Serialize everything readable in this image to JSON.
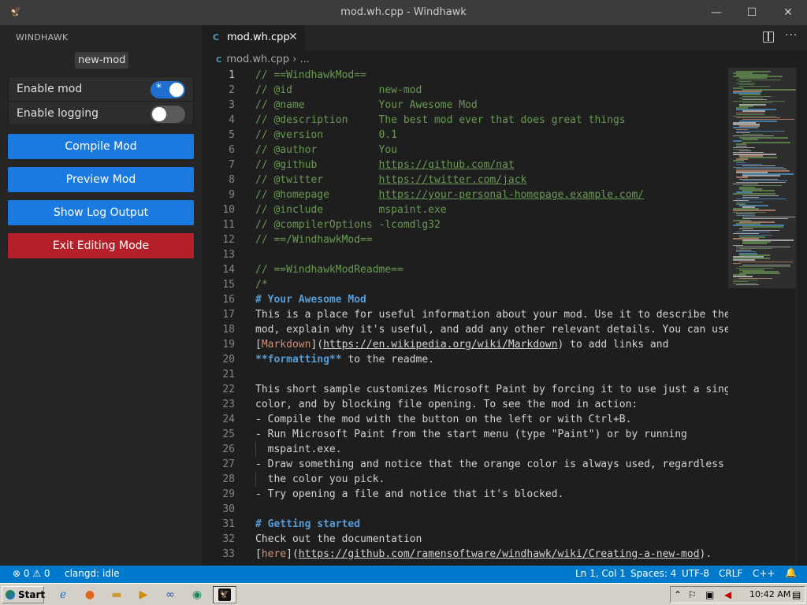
{
  "window": {
    "title": "mod.wh.cpp - Windhawk",
    "minimize": "—",
    "maximize": "☐",
    "close": "✕"
  },
  "sidebar": {
    "heading": "WINDHAWK",
    "mod_name": "new-mod",
    "toggles": [
      {
        "label": "Enable mod",
        "state": "on"
      },
      {
        "label": "Enable logging",
        "state": "off"
      }
    ],
    "buttons": {
      "compile": "Compile Mod",
      "preview": "Preview Mod",
      "log": "Show Log Output",
      "exit": "Exit Editing Mode"
    },
    "colors": {
      "primary": "#1a7ae0",
      "danger": "#b3202a"
    }
  },
  "editor": {
    "tab_label": "mod.wh.cpp",
    "tab_icon": "C",
    "breadcrumb_file": "mod.wh.cpp",
    "breadcrumb_rest": "...",
    "lines": [
      {
        "n": "1",
        "parts": [
          [
            "cm",
            "// ==WindhawkMod=="
          ]
        ]
      },
      {
        "n": "2",
        "parts": [
          [
            "cm",
            "// @id              new-mod"
          ]
        ]
      },
      {
        "n": "3",
        "parts": [
          [
            "cm",
            "// @name            Your Awesome Mod"
          ]
        ]
      },
      {
        "n": "4",
        "parts": [
          [
            "cm",
            "// @description     The best mod ever that does great things"
          ]
        ]
      },
      {
        "n": "5",
        "parts": [
          [
            "cm",
            "// @version         0.1"
          ]
        ]
      },
      {
        "n": "6",
        "parts": [
          [
            "cm",
            "// @author          You"
          ]
        ]
      },
      {
        "n": "7",
        "parts": [
          [
            "cm",
            "// @github          "
          ],
          [
            "lnk",
            "https://github.com/nat"
          ]
        ]
      },
      {
        "n": "8",
        "parts": [
          [
            "cm",
            "// @twitter         "
          ],
          [
            "lnk",
            "https://twitter.com/jack"
          ]
        ]
      },
      {
        "n": "9",
        "parts": [
          [
            "cm",
            "// @homepage        "
          ],
          [
            "lnk",
            "https://your-personal-homepage.example.com/"
          ]
        ]
      },
      {
        "n": "10",
        "parts": [
          [
            "cm",
            "// @include         mspaint.exe"
          ]
        ]
      },
      {
        "n": "11",
        "parts": [
          [
            "cm",
            "// @compilerOptions -lcomdlg32"
          ]
        ]
      },
      {
        "n": "12",
        "parts": [
          [
            "cm",
            "// ==/WindhawkMod=="
          ]
        ]
      },
      {
        "n": "13",
        "parts": []
      },
      {
        "n": "14",
        "parts": [
          [
            "cm",
            "// ==WindhawkModReadme=="
          ]
        ]
      },
      {
        "n": "15",
        "parts": [
          [
            "cm",
            "/*"
          ]
        ]
      },
      {
        "n": "16",
        "parts": [
          [
            "hd",
            "# Your Awesome Mod"
          ]
        ]
      },
      {
        "n": "17",
        "parts": [
          [
            "txt",
            "This is a place for useful information about your mod. Use it to describe the"
          ]
        ]
      },
      {
        "n": "18",
        "parts": [
          [
            "txt",
            "mod, explain why it's useful, and add any other relevant details. You can use"
          ]
        ]
      },
      {
        "n": "19",
        "parts": [
          [
            "txt",
            "["
          ],
          [
            "md-lnk",
            "Markdown"
          ],
          [
            "txt",
            "]("
          ],
          [
            "txt-u",
            "https://en.wikipedia.org/wiki/Markdown"
          ],
          [
            "txt",
            ") to add links and"
          ]
        ]
      },
      {
        "n": "20",
        "parts": [
          [
            "hd",
            "**formatting**"
          ],
          [
            "txt",
            " to the readme."
          ]
        ]
      },
      {
        "n": "21",
        "parts": []
      },
      {
        "n": "22",
        "parts": [
          [
            "txt",
            "This short sample customizes Microsoft Paint by forcing it to use just a singl"
          ]
        ]
      },
      {
        "n": "23",
        "parts": [
          [
            "txt",
            "color, and by blocking file opening. To see the mod in action:"
          ]
        ]
      },
      {
        "n": "24",
        "parts": [
          [
            "txt",
            "- Compile the mod with the button on the left or with Ctrl+B."
          ]
        ]
      },
      {
        "n": "25",
        "parts": [
          [
            "txt",
            "- Run Microsoft Paint from the start menu (type \"Paint\") or by running"
          ]
        ]
      },
      {
        "n": "26",
        "parts": [
          [
            "txt",
            "  mspaint.exe."
          ]
        ]
      },
      {
        "n": "27",
        "parts": [
          [
            "txt",
            "- Draw something and notice that the orange color is always used, regardless o"
          ]
        ]
      },
      {
        "n": "28",
        "parts": [
          [
            "txt",
            "  the color you pick."
          ]
        ]
      },
      {
        "n": "29",
        "parts": [
          [
            "txt",
            "- Try opening a file and notice that it's blocked."
          ]
        ]
      },
      {
        "n": "30",
        "parts": []
      },
      {
        "n": "31",
        "parts": [
          [
            "hd",
            "# Getting started"
          ]
        ]
      },
      {
        "n": "32",
        "parts": [
          [
            "txt",
            "Check out the documentation"
          ]
        ]
      },
      {
        "n": "33",
        "parts": [
          [
            "txt",
            "["
          ],
          [
            "md-lnk",
            "here"
          ],
          [
            "txt",
            "]("
          ],
          [
            "txt-u",
            "https://github.com/ramensoftware/windhawk/wiki/Creating-a-new-mod"
          ],
          [
            "txt",
            ")."
          ]
        ]
      }
    ]
  },
  "statusbar": {
    "problems": "⊗ 0 ⚠ 0",
    "language_server": "clangd: idle",
    "cursor_pos": "Ln 1, Col 1",
    "spaces": "Spaces: 4",
    "encoding": "UTF-8",
    "eol": "CRLF",
    "language": "C++",
    "bell": "🔔",
    "color": "#007acc"
  },
  "taskbar": {
    "start_label": "Start",
    "clock": "10:42 AM"
  }
}
